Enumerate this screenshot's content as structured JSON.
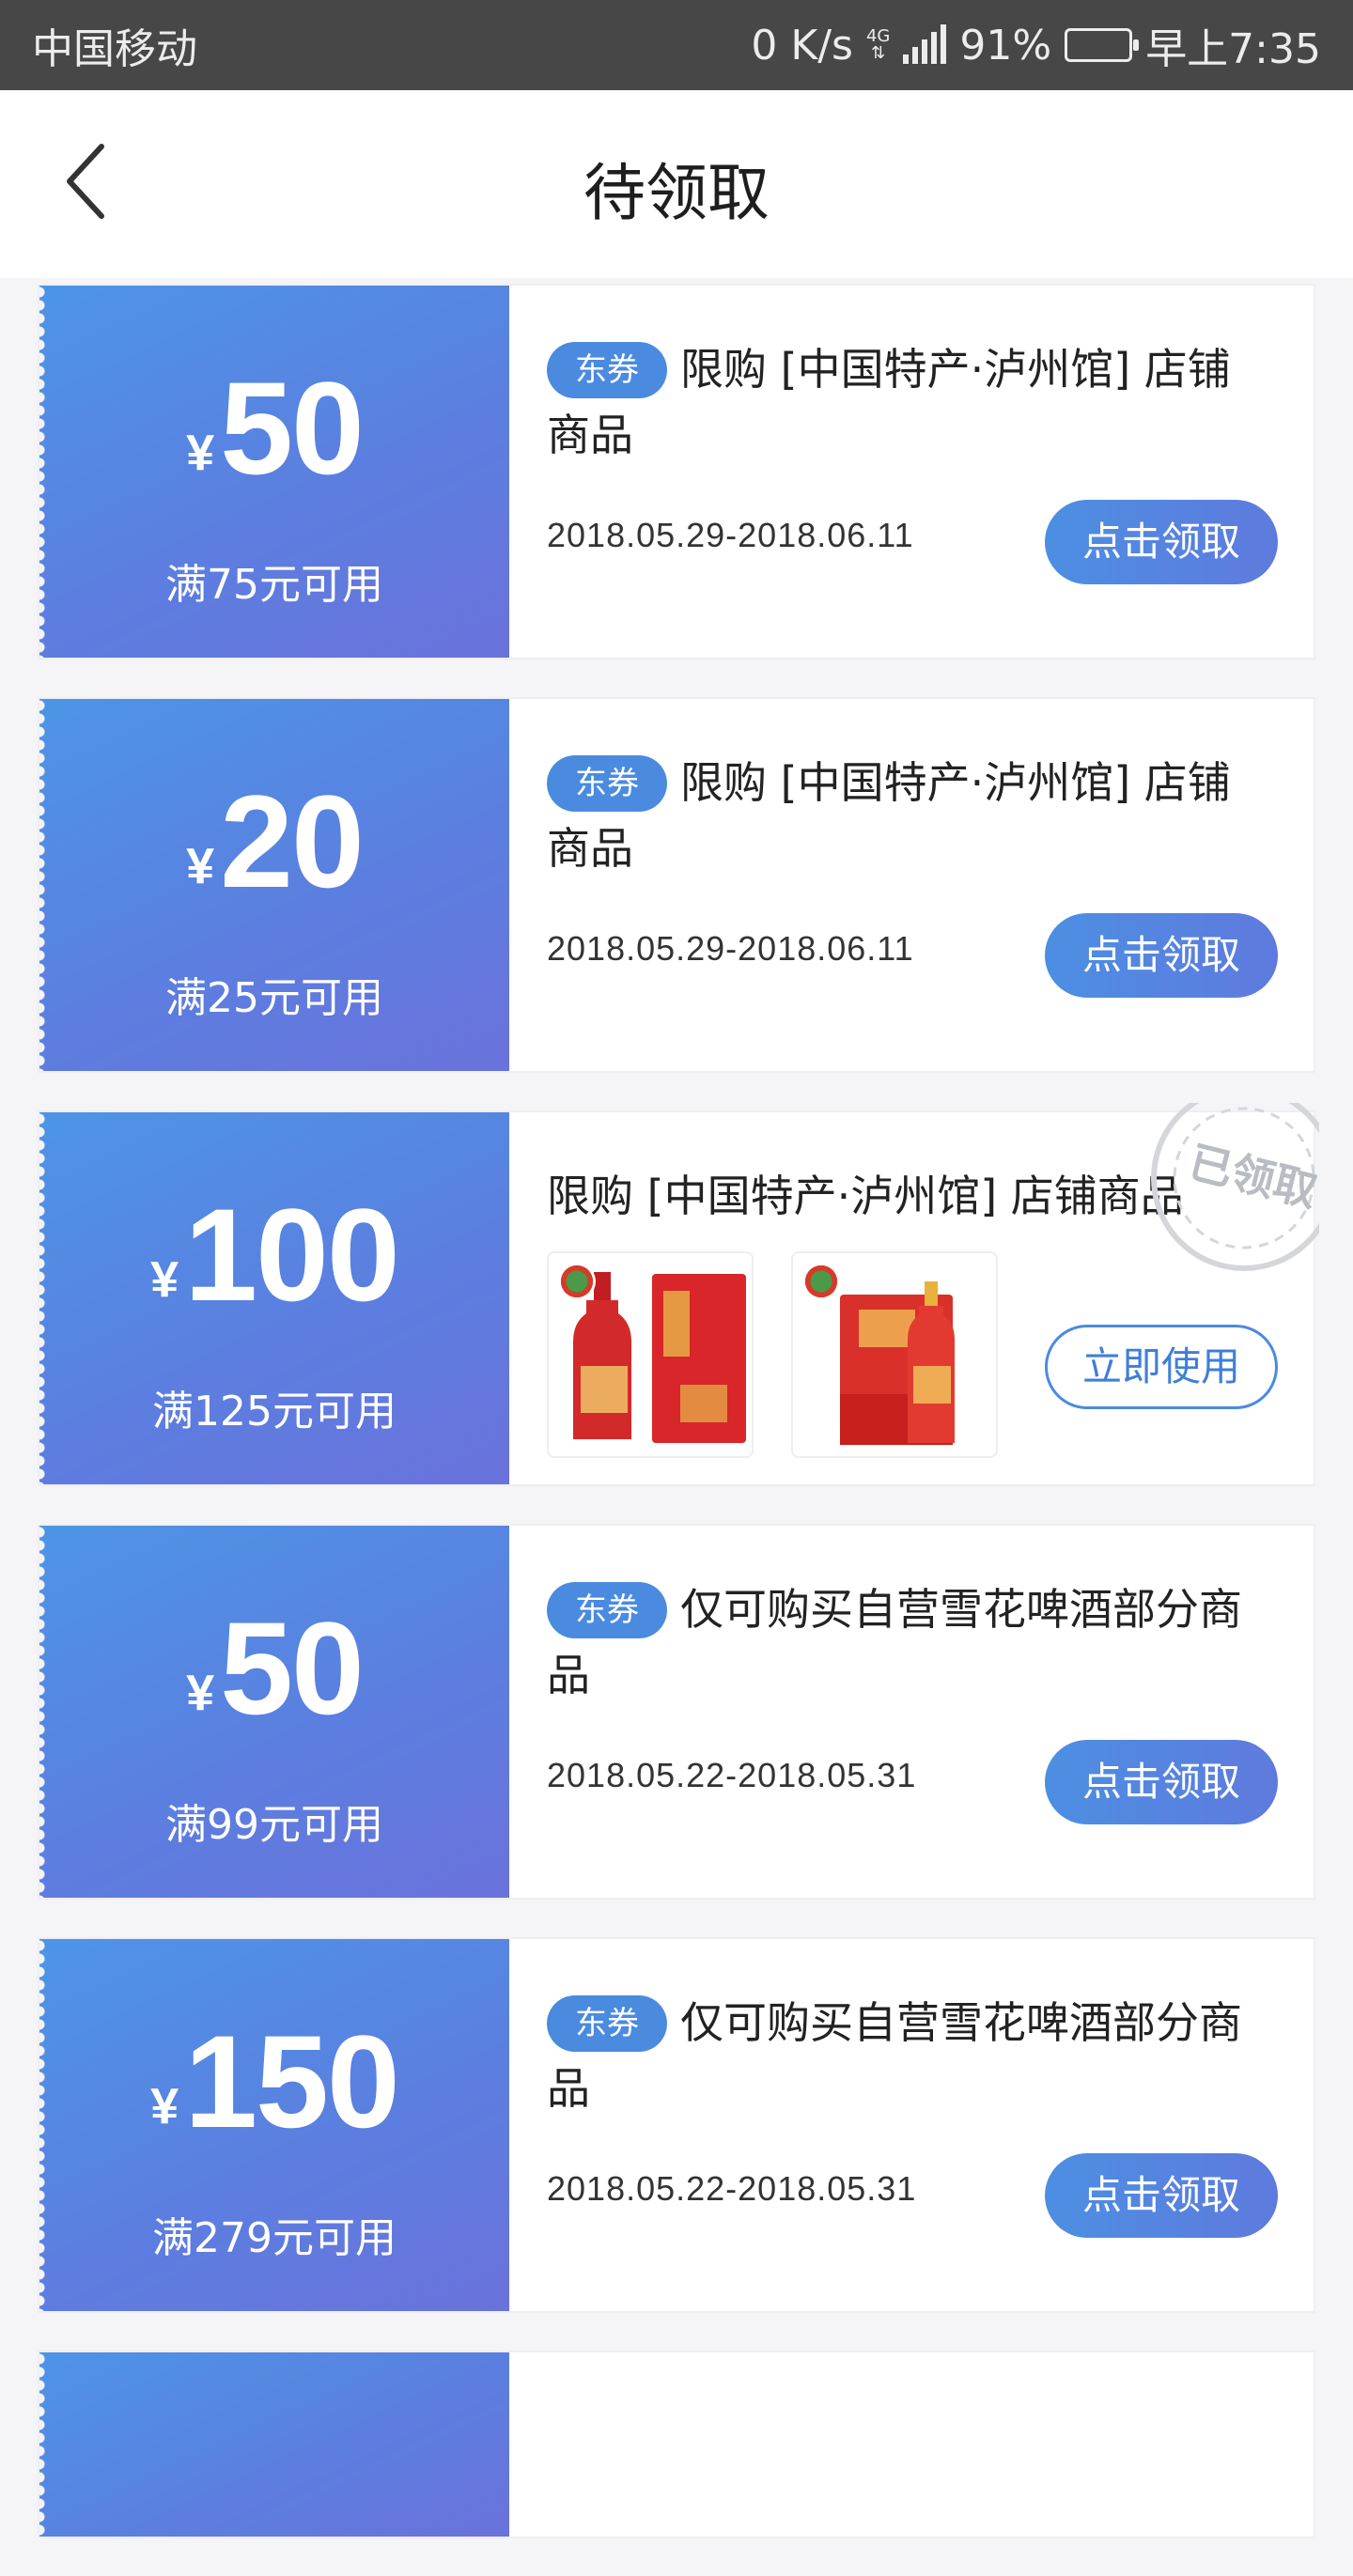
{
  "status_bar": {
    "carrier": "中国移动",
    "speed": "0 K/s",
    "network": "4G",
    "battery_level": 0.91,
    "battery": "91%",
    "time": "早上7:35"
  },
  "nav": {
    "back_icon": "chevron-left-icon",
    "title": "待领取"
  },
  "colors": {
    "coupon_gradient_start": "#4d95e6",
    "coupon_gradient_end": "#6a72dc",
    "accent": "#4a8be0"
  },
  "coupons": [
    {
      "currency": "¥",
      "amount": "50",
      "condition": "满75元可用",
      "tag": "东券",
      "description": "限购 [中国特产·泸州馆] 店铺商品",
      "date_range": "2018.05.29-2018.06.11",
      "button": "点击领取"
    },
    {
      "currency": "¥",
      "amount": "20",
      "condition": "满25元可用",
      "tag": "东券",
      "description": "限购 [中国特产·泸州馆] 店铺商品",
      "date_range": "2018.05.29-2018.06.11",
      "button": "点击领取"
    },
    {
      "currency": "¥",
      "amount": "100",
      "condition": "满125元可用",
      "description": "限购 [中国特产·泸州馆] 店铺商品",
      "stamp": "已领取",
      "button": "立即使用"
    },
    {
      "currency": "¥",
      "amount": "50",
      "condition": "满99元可用",
      "tag": "东券",
      "description": "仅可购买自营雪花啤酒部分商品",
      "date_range": "2018.05.22-2018.05.31",
      "button": "点击领取"
    },
    {
      "currency": "¥",
      "amount": "150",
      "condition": "满279元可用",
      "tag": "东券",
      "description": "仅可购买自营雪花啤酒部分商品",
      "date_range": "2018.05.22-2018.05.31",
      "button": "点击领取"
    }
  ]
}
